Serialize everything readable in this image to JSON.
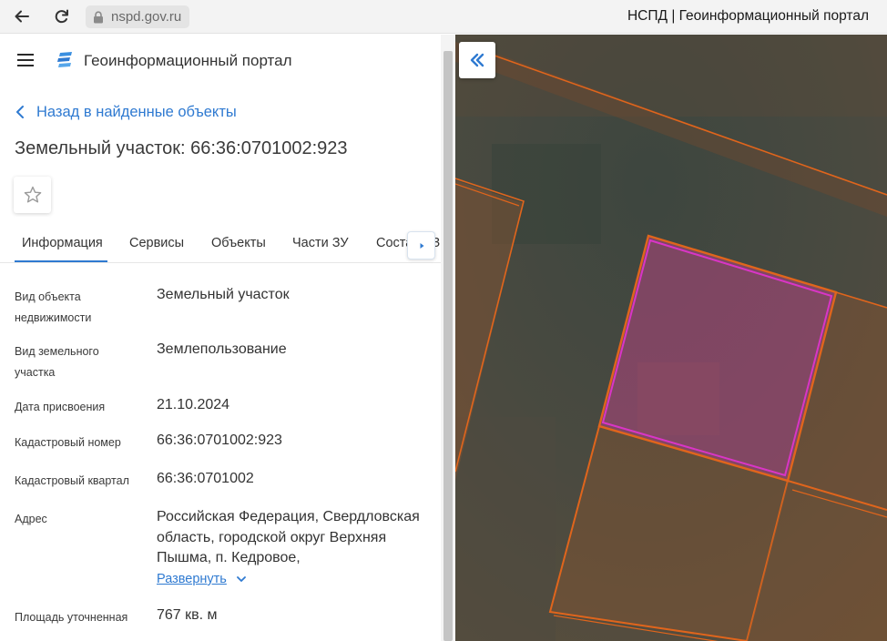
{
  "browser": {
    "url": "nspd.gov.ru",
    "tab_title": "НСПД | Геоинформационный портал",
    "back_icon": "arrow-left-icon",
    "reload_icon": "reload-icon",
    "lock_icon": "lock-icon"
  },
  "app": {
    "title": "Геоинформационный портал",
    "menu_icon": "hamburger-menu-icon",
    "logo_icon": "portal-logo-icon",
    "accent_color": "#2f7ad1"
  },
  "nav": {
    "back_label": "Назад в найденные объекты"
  },
  "object": {
    "title": "Земельный участок: 66:36:0701002:923",
    "favorite_icon": "star-outline-icon"
  },
  "tabs": [
    {
      "label": "Информация",
      "active": true
    },
    {
      "label": "Сервисы",
      "active": false
    },
    {
      "label": "Объекты",
      "active": false
    },
    {
      "label": "Части ЗУ",
      "active": false
    },
    {
      "label": "Состав ЕЗ",
      "active": false
    }
  ],
  "info": {
    "rows": [
      {
        "label": "Вид объекта недвижимости",
        "value": "Земельный участок"
      },
      {
        "label": "Вид земельного участка",
        "value": "Землепользование"
      },
      {
        "label": "Дата присвоения",
        "value": "21.10.2024"
      },
      {
        "label": "Кадастровый номер",
        "value": "66:36:0701002:923"
      },
      {
        "label": "Кадастровый квартал",
        "value": "66:36:0701002"
      },
      {
        "label": "Адрес",
        "value": "Российская Федерация, Свердловская область, городской округ Верхняя Пышма, п. Кедровое,"
      },
      {
        "label": "Площадь уточненная",
        "value": "767 кв. м"
      }
    ],
    "expand_label": "Развернуть"
  },
  "map": {
    "collapse_icon": "double-chevron-left-icon",
    "parcel_color": "#e0651c",
    "selected_color": "#d935c6"
  }
}
